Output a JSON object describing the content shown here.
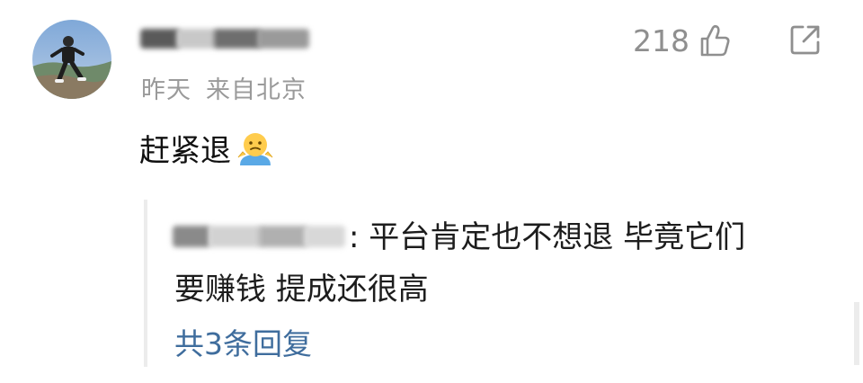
{
  "comment": {
    "username_redacted": true,
    "time": "昨天",
    "location": "来自北京",
    "likes": "218",
    "text": "赶紧退",
    "emoji": "shrug-emoji"
  },
  "reply": {
    "username_redacted": true,
    "text_line1": ": 平台肯定也不想退 毕竟它们",
    "text_line2": "要赚钱 提成还很高",
    "reply_count": "共3条回复"
  },
  "icons": {
    "like": "thumb-up-icon",
    "share": "share-icon"
  },
  "colors": {
    "meta": "#9a9a9a",
    "link": "#3f6d9d",
    "text": "#111111",
    "divider": "#ececec"
  }
}
